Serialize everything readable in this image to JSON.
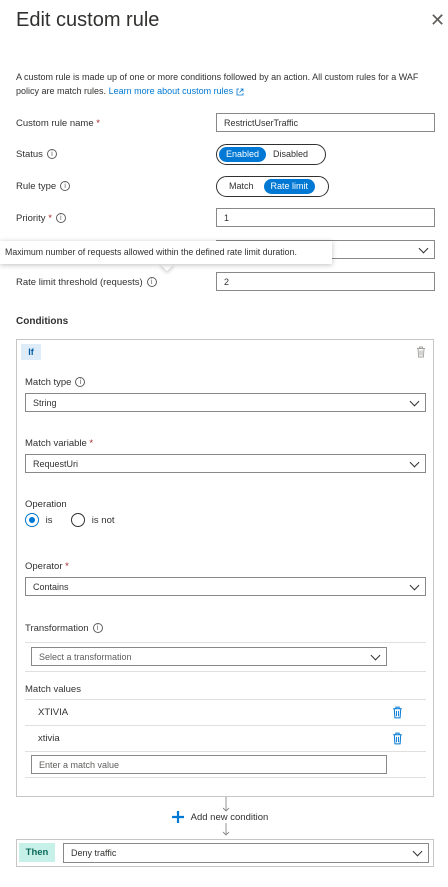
{
  "header": {
    "title": "Edit custom rule",
    "close_glyph": "✕"
  },
  "description": {
    "text": "A custom rule is made up of one or more conditions followed by an action. All custom rules for a WAF policy are match rules.",
    "link": "Learn more about custom rules"
  },
  "fields": {
    "rule_name_label": "Custom rule name",
    "rule_name_value": "RestrictUserTraffic",
    "status_label": "Status",
    "status_options": [
      "Enabled",
      "Disabled"
    ],
    "rule_type_label": "Rule type",
    "rule_type_options": [
      "Match",
      "Rate limit"
    ],
    "priority_label": "Priority",
    "priority_value": "1",
    "threshold_label": "Rate limit threshold (requests)",
    "threshold_value": "2",
    "required_marker": "*",
    "info_glyph": "i"
  },
  "tooltip": {
    "text": "Maximum number of requests allowed within the defined rate limit duration."
  },
  "conditions": {
    "heading": "Conditions",
    "if_label": "If",
    "match_type_label": "Match type",
    "match_type_value": "String",
    "match_variable_label": "Match variable",
    "match_variable_value": "RequestUri",
    "operation_label": "Operation",
    "operation_options": [
      "is",
      "is not"
    ],
    "operator_label": "Operator",
    "operator_value": "Contains",
    "transformation_label": "Transformation",
    "transformation_placeholder": "Select a transformation",
    "match_values_label": "Match values",
    "match_values": [
      "XTIVIA",
      "xtivia"
    ],
    "match_value_placeholder": "Enter a match value"
  },
  "add_condition": {
    "label": "Add new condition"
  },
  "then": {
    "label": "Then",
    "action_value": "Deny traffic"
  },
  "colors": {
    "accent": "#0078d4",
    "required": "#a4262c",
    "then_badge": "#c7f0e8",
    "if_badge": "#deecf9"
  },
  "icons": [
    "close-icon",
    "info-icon",
    "external-link-icon",
    "trash-icon",
    "chevron-down-icon",
    "plus-icon"
  ]
}
